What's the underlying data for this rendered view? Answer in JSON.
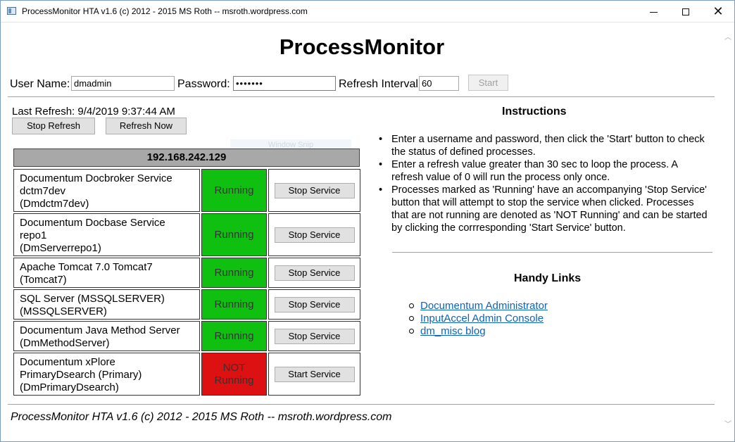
{
  "window": {
    "title": "ProcessMonitor HTA v1.6 (c) 2012 - 2015 MS Roth -- msroth.wordpress.com",
    "close_glyph": "✕"
  },
  "app": {
    "title": "ProcessMonitor"
  },
  "form": {
    "username_label": "User Name:",
    "username_value": "dmadmin",
    "password_label": "Password:",
    "password_value": "•••••••",
    "refresh_label": "Refresh Interval:",
    "refresh_value": "60",
    "start_label": "Start"
  },
  "status": {
    "last_refresh": "Last Refresh: 9/4/2019 9:37:44 AM",
    "stop_refresh_label": "Stop Refresh",
    "refresh_now_label": "Refresh Now",
    "ghost_text": "Window Snip"
  },
  "host": {
    "address": "192.168.242.129"
  },
  "services": [
    {
      "line1": "Documentum Docbroker Service",
      "line2": "dctm7dev",
      "line3": "(Dmdctm7dev)",
      "status": "Running",
      "action": "Stop Service",
      "state_color": "#10c010"
    },
    {
      "line1": "Documentum Docbase Service",
      "line2": "repo1",
      "line3": "(DmServerrepo1)",
      "status": "Running",
      "action": "Stop Service",
      "state_color": "#10c010"
    },
    {
      "line1": "Apache Tomcat 7.0 Tomcat7",
      "line2": "(Tomcat7)",
      "line3": "",
      "status": "Running",
      "action": "Stop Service",
      "state_color": "#10c010"
    },
    {
      "line1": "SQL Server (MSSQLSERVER)",
      "line2": "(MSSQLSERVER)",
      "line3": "",
      "status": "Running",
      "action": "Stop Service",
      "state_color": "#10c010"
    },
    {
      "line1": "Documentum Java Method Server",
      "line2": "(DmMethodServer)",
      "line3": "",
      "status": "Running",
      "action": "Stop Service",
      "state_color": "#10c010"
    },
    {
      "line1": "Documentum xPlore",
      "line2": "PrimaryDsearch (Primary)",
      "line3": "(DmPrimaryDsearch)",
      "status_line1": "NOT",
      "status_line2": "Running",
      "action": "Start Service",
      "state_color": "#dd1111"
    }
  ],
  "instructions": {
    "title": "Instructions",
    "items": [
      "Enter a username and password, then click the 'Start' button to check the status of defined processes.",
      "Enter a refresh value greater than 30 sec to loop the process. A refresh value of 0 will run the process only once.",
      "Processes marked as 'Running' have an accompanying 'Stop Service' button that will attempt to stop the service when clicked. Processes that are not running are denoted as 'NOT Running' and can be started by clicking the corrresponding 'Start Service' button."
    ]
  },
  "links": {
    "title": "Handy Links",
    "items": [
      "Documentum Administrator",
      "InputAccel Admin Console",
      "dm_misc blog"
    ]
  },
  "footer": {
    "text": "ProcessMonitor HTA v1.6 (c) 2012 - 2015 MS Roth -- msroth.wordpress.com"
  },
  "colors": {
    "running": "#10c010",
    "not_running": "#dd1111",
    "link": "#0b63c4",
    "host_header": "#a8a8a8"
  }
}
